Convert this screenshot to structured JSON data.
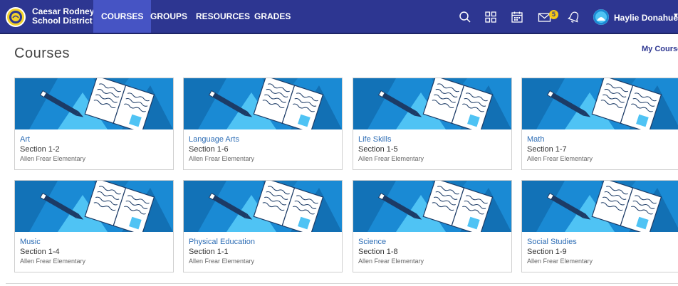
{
  "header": {
    "school_name_line1": "Caesar Rodney",
    "school_name_line2": "School District",
    "nav": [
      "COURSES",
      "GROUPS",
      "RESOURCES",
      "GRADES"
    ],
    "active_nav": "COURSES",
    "mail_badge": "5",
    "user_name": "Haylie Donahue",
    "icons": [
      "search-icon",
      "apps-grid-icon",
      "calendar-icon",
      "mail-icon",
      "notification-icon",
      "avatar-icon",
      "chevron-down-icon"
    ],
    "colors": {
      "bar": "#2d3691",
      "active": "#4654c4",
      "badge": "#f4c816"
    }
  },
  "page": {
    "title": "Courses",
    "my_courses_link": "My Courses"
  },
  "courses": [
    {
      "title": "Art",
      "section": "Section 1-2",
      "school": "Allen Frear Elementary"
    },
    {
      "title": "Language Arts",
      "section": "Section 1-6",
      "school": "Allen Frear Elementary"
    },
    {
      "title": "Life Skills",
      "section": "Section 1-5",
      "school": "Allen Frear Elementary"
    },
    {
      "title": "Math",
      "section": "Section 1-7",
      "school": "Allen Frear Elementary"
    },
    {
      "title": "Music",
      "section": "Section 1-4",
      "school": "Allen Frear Elementary"
    },
    {
      "title": "Physical Education",
      "section": "Section 1-1",
      "school": "Allen Frear Elementary"
    },
    {
      "title": "Science",
      "section": "Section 1-8",
      "school": "Allen Frear Elementary"
    },
    {
      "title": "Social Studies",
      "section": "Section 1-9",
      "school": "Allen Frear Elementary"
    }
  ],
  "banner_colors": {
    "base": "#1a8ad4",
    "dark": "#0d5f9e",
    "light": "#4fc3f4"
  }
}
